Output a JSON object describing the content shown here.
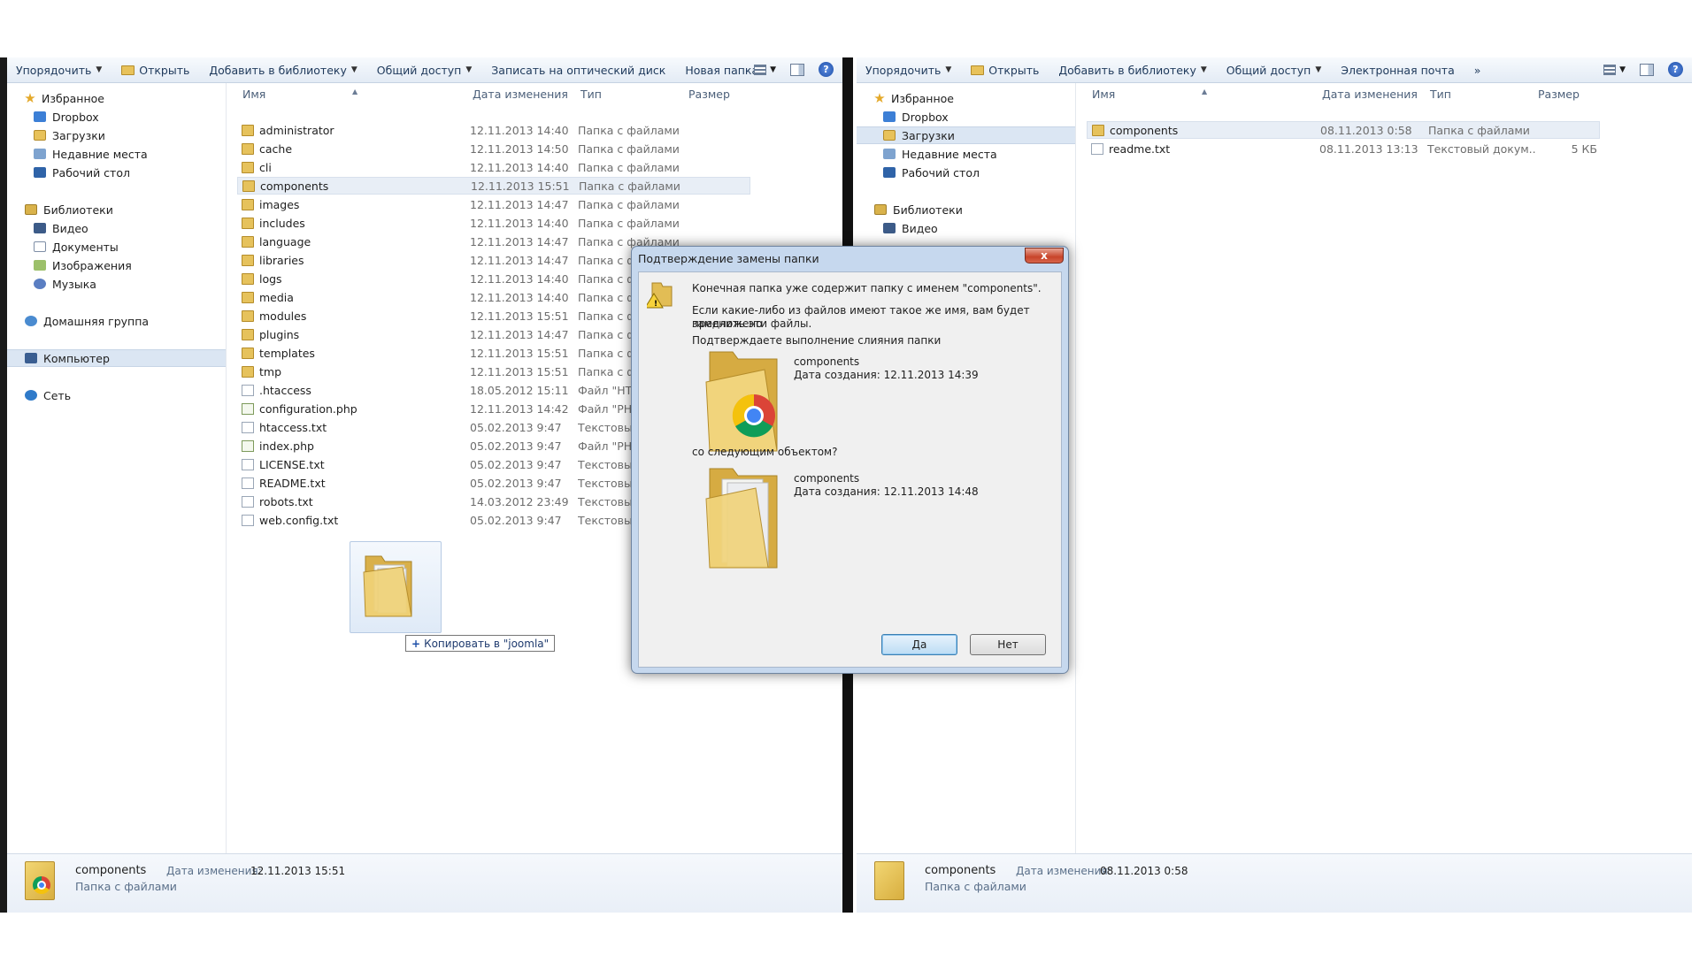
{
  "left_pane": {
    "toolbar": {
      "organize": "Упорядочить",
      "open": "Открыть",
      "add_library": "Добавить в библиотеку",
      "share": "Общий доступ",
      "burn": "Записать на оптический диск",
      "new_folder": "Новая папка"
    },
    "nav": {
      "favorites": "Избранное",
      "dropbox": "Dropbox",
      "downloads": "Загрузки",
      "recent": "Недавние места",
      "desktop": "Рабочий стол",
      "libraries": "Библиотеки",
      "video": "Видео",
      "documents": "Документы",
      "images": "Изображения",
      "music": "Музыка",
      "homegroup": "Домашняя группа",
      "computer": "Компьютер",
      "network": "Сеть"
    },
    "columns": {
      "name": "Имя",
      "date": "Дата изменения",
      "type": "Тип",
      "size": "Размер"
    },
    "files": [
      {
        "name": "administrator",
        "date": "12.11.2013 14:40",
        "type": "Папка с файлами"
      },
      {
        "name": "cache",
        "date": "12.11.2013 14:50",
        "type": "Папка с файлами"
      },
      {
        "name": "cli",
        "date": "12.11.2013 14:40",
        "type": "Папка с файлами"
      },
      {
        "name": "components",
        "date": "12.11.2013 15:51",
        "type": "Папка с файлами"
      },
      {
        "name": "images",
        "date": "12.11.2013 14:47",
        "type": "Папка с файлами"
      },
      {
        "name": "includes",
        "date": "12.11.2013 14:40",
        "type": "Папка с файлами"
      },
      {
        "name": "language",
        "date": "12.11.2013 14:47",
        "type": "Папка с файлами"
      },
      {
        "name": "libraries",
        "date": "12.11.2013 14:47",
        "type": "Папка с файлами"
      },
      {
        "name": "logs",
        "date": "12.11.2013 14:40",
        "type": "Папка с файлами"
      },
      {
        "name": "media",
        "date": "12.11.2013 14:40",
        "type": "Папка с файлами"
      },
      {
        "name": "modules",
        "date": "12.11.2013 15:51",
        "type": "Папка с файлами"
      },
      {
        "name": "plugins",
        "date": "12.11.2013 14:47",
        "type": "Папка с файлами"
      },
      {
        "name": "templates",
        "date": "12.11.2013 15:51",
        "type": "Папка с файлами"
      },
      {
        "name": "tmp",
        "date": "12.11.2013 15:51",
        "type": "Папка с файлами"
      },
      {
        "name": ".htaccess",
        "date": "18.05.2012 15:11",
        "type": "Файл \"HTACCESS\""
      },
      {
        "name": "configuration.php",
        "date": "12.11.2013 14:42",
        "type": "Файл \"PHP\""
      },
      {
        "name": "htaccess.txt",
        "date": "05.02.2013 9:47",
        "type": "Текстовый документ"
      },
      {
        "name": "index.php",
        "date": "05.02.2013 9:47",
        "type": "Файл \"PHP\""
      },
      {
        "name": "LICENSE.txt",
        "date": "05.02.2013 9:47",
        "type": "Текстовый документ"
      },
      {
        "name": "README.txt",
        "date": "05.02.2013 9:47",
        "type": "Текстовый документ"
      },
      {
        "name": "robots.txt",
        "date": "14.03.2012 23:49",
        "type": "Текстовый документ"
      },
      {
        "name": "web.config.txt",
        "date": "05.02.2013 9:47",
        "type": "Текстовый документ"
      }
    ],
    "status": {
      "name": "components",
      "type": "Папка с файлами",
      "date_label": "Дата изменения:",
      "date": "12.11.2013 15:51"
    },
    "drag_tip": "Копировать в \"joomla\""
  },
  "right_pane": {
    "toolbar": {
      "organize": "Упорядочить",
      "open": "Открыть",
      "add_library": "Добавить в библиотеку",
      "share": "Общий доступ",
      "email": "Электронная почта",
      "more": "»"
    },
    "nav": {
      "favorites": "Избранное",
      "dropbox": "Dropbox",
      "downloads": "Загрузки",
      "recent": "Недавние места",
      "desktop": "Рабочий стол",
      "libraries": "Библиотеки",
      "video": "Видео"
    },
    "columns": {
      "name": "Имя",
      "date": "Дата изменения",
      "type": "Тип",
      "size": "Размер"
    },
    "files": [
      {
        "name": "components",
        "date": "08.11.2013 0:58",
        "type": "Папка с файлами",
        "size": ""
      },
      {
        "name": "readme.txt",
        "date": "08.11.2013 13:13",
        "type": "Текстовый докум...",
        "size": "5 КБ"
      }
    ],
    "status": {
      "name": "components",
      "type": "Папка с файлами",
      "date_label": "Дата изменения:",
      "date": "08.11.2013 0:58"
    }
  },
  "dialog": {
    "title": "Подтверждение замены папки",
    "close": "x",
    "line1": "Конечная папка уже содержит папку с именем \"components\".",
    "line2a": "Если какие-либо из файлов имеют такое же имя, вам будет предложено",
    "line2b": "заменить эти файлы.",
    "line3": "Подтверждаете выполнение слияния папки",
    "src_name": "components",
    "src_date": "Дата создания: 12.11.2013 14:39",
    "with_label": "со следующим объектом?",
    "dst_name": "components",
    "dst_date": "Дата создания: 12.11.2013 14:48",
    "yes": "Да",
    "no": "Нет"
  }
}
